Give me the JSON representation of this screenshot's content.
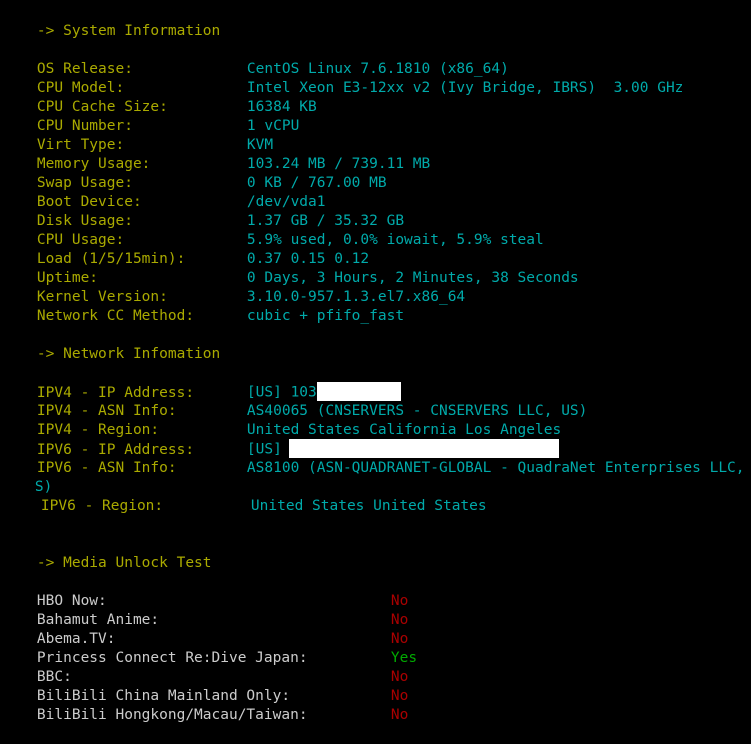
{
  "terminal": {
    "background_color": "#000000",
    "label_color": "#aaaa00",
    "value_color": "#00aaaa",
    "media_label_color": "#cccccc",
    "yes_color": "#00aa00",
    "no_color": "#aa0000",
    "redaction_color": "#ffffff"
  },
  "sections": {
    "system": {
      "heading": "-> System Information",
      "rows": [
        {
          "label": "OS Release:",
          "value": "CentOS Linux 7.6.1810 (x86_64)"
        },
        {
          "label": "CPU Model:",
          "value": "Intel Xeon E3-12xx v2 (Ivy Bridge, IBRS)  3.00 GHz"
        },
        {
          "label": "CPU Cache Size:",
          "value": "16384 KB"
        },
        {
          "label": "CPU Number:",
          "value": "1 vCPU"
        },
        {
          "label": "Virt Type:",
          "value": "KVM"
        },
        {
          "label": "Memory Usage:",
          "value": "103.24 MB / 739.11 MB"
        },
        {
          "label": "Swap Usage:",
          "value": "0 KB / 767.00 MB"
        },
        {
          "label": "Boot Device:",
          "value": "/dev/vda1"
        },
        {
          "label": "Disk Usage:",
          "value": "1.37 GB / 35.32 GB"
        },
        {
          "label": "CPU Usage:",
          "value": "5.9% used, 0.0% iowait, 5.9% steal"
        },
        {
          "label": "Load (1/5/15min):",
          "value": "0.37 0.15 0.12"
        },
        {
          "label": "Uptime:",
          "value": "0 Days, 3 Hours, 2 Minutes, 38 Seconds"
        },
        {
          "label": "Kernel Version:",
          "value": "3.10.0-957.1.3.el7.x86_64"
        },
        {
          "label": "Network CC Method:",
          "value": "cubic + pfifo_fast"
        }
      ]
    },
    "network": {
      "heading": "-> Network Infomation",
      "ipv4_ip_label": "IPV4 - IP Address:",
      "ipv4_ip_value": "[US] 103",
      "ipv4_asn_label": "IPV4 - ASN Info:",
      "ipv4_asn_value": "AS40065 (CNSERVERS - CNSERVERS LLC, US)",
      "ipv4_region_label": "IPV4 - Region:",
      "ipv4_region_value": "United States California Los Angeles",
      "ipv6_ip_label": "IPV6 - IP Address:",
      "ipv6_ip_value": "[US]",
      "ipv6_asn_label": "IPV6 - ASN Info:",
      "ipv6_asn_value_line1": "AS8100 (ASN-QUADRANET-GLOBAL - QuadraNet Enterprises LLC, U",
      "ipv6_asn_value_line2": "S)",
      "ipv6_region_label": "IPV6 - Region:",
      "ipv6_region_value": "United States United States"
    },
    "media": {
      "heading": "-> Media Unlock Test",
      "rows": [
        {
          "label": "HBO Now:",
          "value": "No"
        },
        {
          "label": "Bahamut Anime:",
          "value": "No"
        },
        {
          "label": "Abema.TV:",
          "value": "No"
        },
        {
          "label": "Princess Connect Re:Dive Japan:",
          "value": "Yes"
        },
        {
          "label": "BBC:",
          "value": "No"
        },
        {
          "label": "BiliBili China Mainland Only:",
          "value": "No"
        },
        {
          "label": "BiliBili Hongkong/Macau/Taiwan:",
          "value": "No"
        }
      ]
    }
  }
}
